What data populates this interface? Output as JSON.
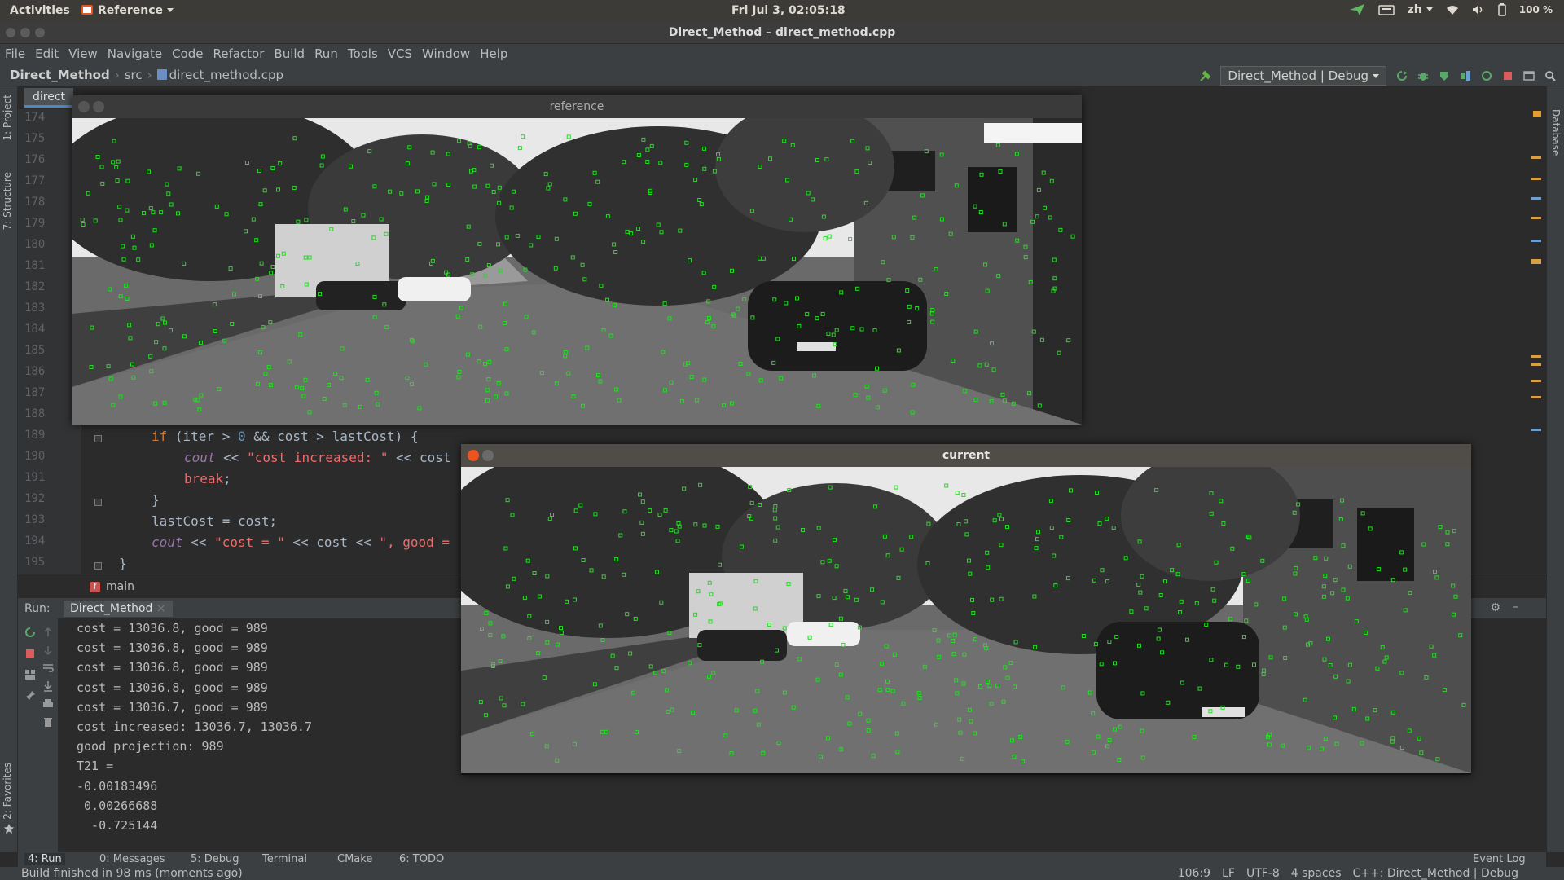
{
  "topbar": {
    "activities": "Activities",
    "app_name": "Reference",
    "clock": "Fri Jul  3, 02:05:18",
    "lang": "zh",
    "battery": "100 %"
  },
  "window": {
    "title": "Direct_Method – direct_method.cpp"
  },
  "menu": [
    "File",
    "Edit",
    "View",
    "Navigate",
    "Code",
    "Refactor",
    "Build",
    "Run",
    "Tools",
    "VCS",
    "Window",
    "Help"
  ],
  "nav": {
    "project": "Direct_Method",
    "folder": "src",
    "file": "direct_method.cpp",
    "run_config": "Direct_Method | Debug"
  },
  "side_tabs": {
    "project": "1: Project",
    "structure": "7: Structure",
    "favorites": "2: Favorites",
    "database": "Database"
  },
  "editor": {
    "tab_label": "direct",
    "line_numbers": [
      "174",
      "175",
      "176",
      "177",
      "178",
      "179",
      "180",
      "181",
      "182",
      "183",
      "184",
      "185",
      "186",
      "187",
      "188",
      "189",
      "190",
      "191",
      "192",
      "193",
      "194",
      "195"
    ],
    "code": {
      "l189_if": "if",
      "l189_a": " (iter > ",
      "l189_num": "0",
      "l189_b": " && cost > lastCost) {",
      "l190_cout": "cout",
      "l190_a": " << ",
      "l190_str": "\"cost increased: \"",
      "l190_b": " << cost",
      "l191_break": "break",
      "l191_semi": ";",
      "l192": "}",
      "l193": "lastCost = cost;",
      "l194_cout": "cout",
      "l194_a": " << ",
      "l194_str1": "\"cost = \"",
      "l194_b": " << cost << ",
      "l194_str2": "\", good =",
      "l195": "}"
    },
    "function_breadcrumb": "main"
  },
  "run_panel": {
    "label": "Run:",
    "tab": "Direct_Method",
    "console": [
      "cost = 13036.8, good = 989",
      "cost = 13036.8, good = 989",
      "cost = 13036.8, good = 989",
      "cost = 13036.8, good = 989",
      "cost = 13036.7, good = 989",
      "cost increased: 13036.7, 13036.7",
      "good projection: 989",
      "T21 =",
      "-0.00183496",
      " 0.00266688",
      "  -0.725144"
    ]
  },
  "tool_tabs": [
    "4: Run",
    "0: Messages",
    "5: Debug",
    "Terminal",
    "CMake",
    "6: TODO",
    "Event Log"
  ],
  "status": {
    "message": "Build finished in 98 ms (moments ago)",
    "position": "106:9",
    "line_sep": "LF",
    "encoding": "UTF-8",
    "indent": "4 spaces",
    "context": "C++: Direct_Method | Debug"
  },
  "windows": {
    "reference_title": "reference",
    "current_title": "current"
  },
  "colors": {
    "feature_point": "#22dd22",
    "close_button": "#e95420",
    "tab_underline": "#4a88c7"
  },
  "icons": [
    "activities-app-icon",
    "send-icon",
    "keyboard-icon",
    "wifi-icon",
    "volume-icon",
    "battery-icon",
    "hammer-icon",
    "rerun-icon",
    "bug-icon",
    "coverage-icon",
    "stop-icon",
    "search-icon",
    "gear-icon",
    "close-icon",
    "minimize-icon",
    "star-icon"
  ]
}
